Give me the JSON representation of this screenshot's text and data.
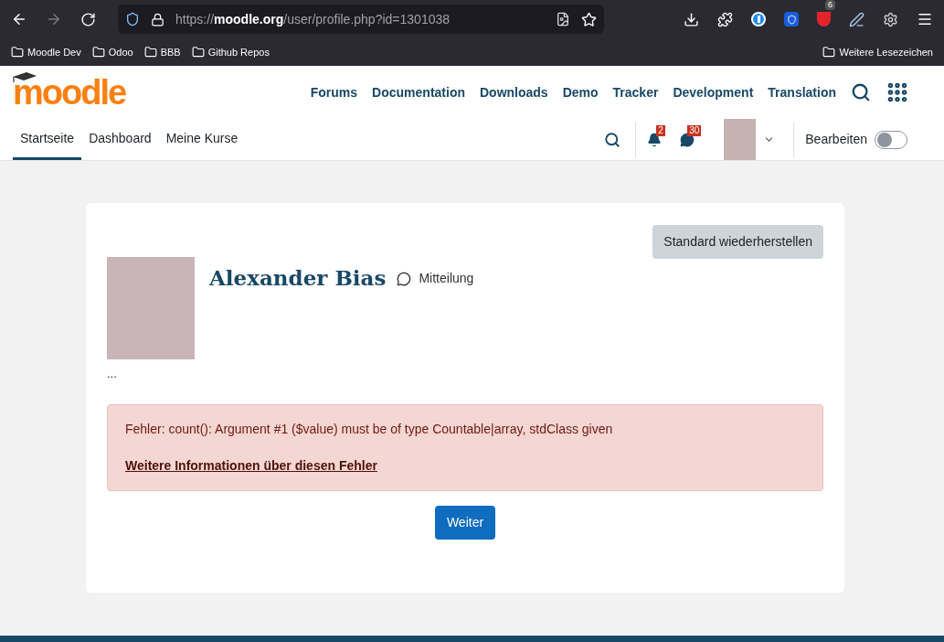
{
  "browser": {
    "url_domain": "moodle.org",
    "url_prefix": "https://",
    "url_path": "/user/profile.php?id=1301038",
    "extension_badge": "6",
    "bookmarks": [
      {
        "label": "Moodle Dev"
      },
      {
        "label": "Odoo"
      },
      {
        "label": "BBB"
      },
      {
        "label": "Github Repos"
      }
    ],
    "other_bookmarks": "Weitere Lesezeichen"
  },
  "site_nav": {
    "logo": "moodle",
    "links": [
      "Forums",
      "Documentation",
      "Downloads",
      "Demo",
      "Tracker",
      "Development",
      "Translation"
    ]
  },
  "primary_nav": {
    "tabs": [
      {
        "label": "Startseite",
        "selected": true
      },
      {
        "label": "Dashboard",
        "selected": false
      },
      {
        "label": "Meine Kurse",
        "selected": false
      }
    ],
    "notifications_count": "2",
    "messages_count": "30",
    "edit_mode": {
      "label": "Bearbeiten",
      "on": false
    }
  },
  "profile": {
    "reset_button": "Standard wiederherstellen",
    "name": "Alexander Bias",
    "message_link": "Mitteilung",
    "ellipsis": "..."
  },
  "error": {
    "message": "Fehler: count(): Argument #1 ($value) must be of type Countable|array, stdClass given",
    "more_info_link": "Weitere Informationen über diesen Fehler"
  },
  "continue_button": "Weiter"
}
